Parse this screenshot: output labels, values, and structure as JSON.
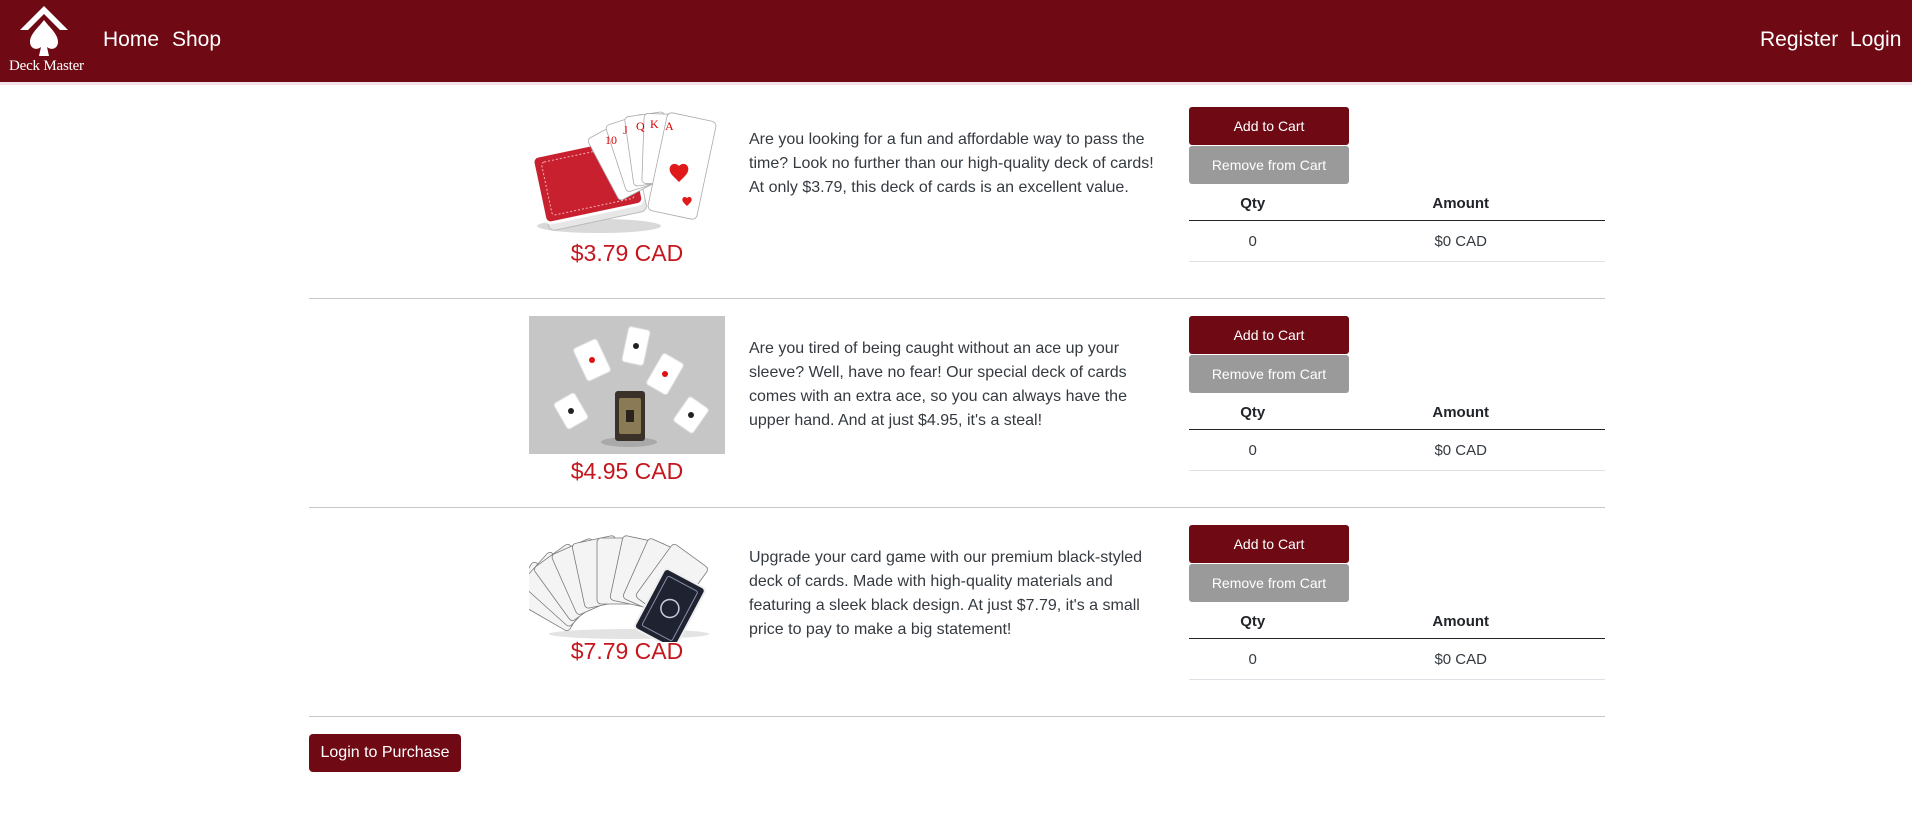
{
  "brand": {
    "name": "Deck Master"
  },
  "nav": {
    "left": [
      {
        "label": "Home"
      },
      {
        "label": "Shop"
      }
    ],
    "right": [
      {
        "label": "Register"
      },
      {
        "label": "Login"
      }
    ]
  },
  "cart_table": {
    "qty_header": "Qty",
    "amount_header": "Amount"
  },
  "products": [
    {
      "image": "royal-flush-deck-photo",
      "price": "$3.79 CAD",
      "description": "Are you looking for a fun and affordable way to pass the time? Look no further than our high-quality deck of cards! At only $3.79, this deck of cards is an excellent value.",
      "add_label": "Add to Cart",
      "remove_label": "Remove from Cart",
      "qty": "0",
      "amount": "$0 CAD"
    },
    {
      "image": "floating-aces-deck-photo",
      "price": "$4.95 CAD",
      "description": "Are you tired of being caught without an ace up your sleeve? Well, have no fear! Our special deck of cards comes with an extra ace, so you can always have the upper hand. And at just $4.95, it's a steal!",
      "add_label": "Add to Cart",
      "remove_label": "Remove from Cart",
      "qty": "0",
      "amount": "$0 CAD"
    },
    {
      "image": "fanned-black-deck-photo",
      "price": "$7.79 CAD",
      "description": "Upgrade your card game with our premium black-styled deck of cards. Made with high-quality materials and featuring a sleek black design. At just $7.79, it's a small price to pay to make a big statement!",
      "add_label": "Add to Cart",
      "remove_label": "Remove from Cart",
      "qty": "0",
      "amount": "$0 CAD"
    }
  ],
  "footer": {
    "login_to_purchase": "Login to Purchase"
  },
  "colors": {
    "brand": "#6f0a15",
    "price": "#c4161c",
    "remove_button": "#9a9a9a"
  }
}
